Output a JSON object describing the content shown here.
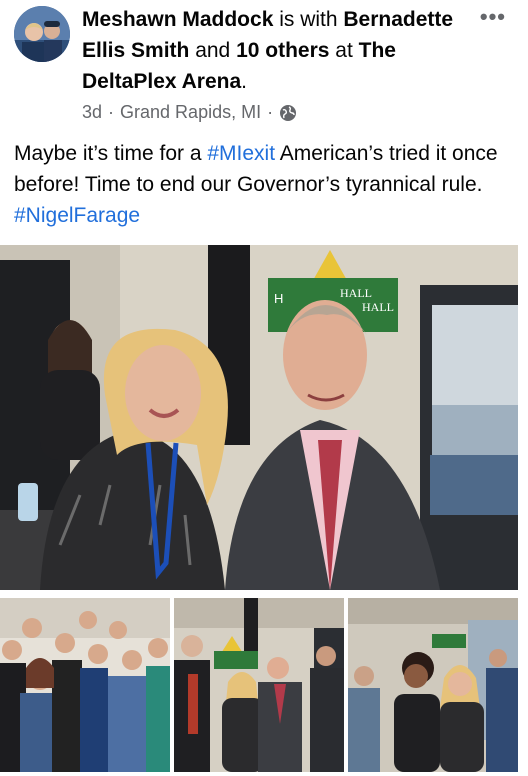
{
  "post": {
    "author": "Meshawn Maddock",
    "with_text": " is with ",
    "tagged_person": "Bernadette Ellis Smith",
    "and_text": " and ",
    "others": "10 others",
    "at_text": " at ",
    "location_place": "The DeltaPlex Arena",
    "period": ".",
    "time_ago": "3d",
    "separator": "·",
    "city": "Grand Rapids, MI",
    "separator2": "·",
    "privacy_icon": "globe-icon",
    "more_icon": "•••",
    "text_part1": "Maybe it’s time for a ",
    "hashtag1": "#MIexit",
    "text_part2": " American’s tried it once before! Time to end our Governor’s tyrannical rule. ",
    "hashtag2": "#NigelFarage"
  },
  "photos": {
    "main_sign_text_1": "HALL",
    "main_sign_text_2": "HALL",
    "main_sign_prefix": "H"
  },
  "colors": {
    "hashtag": "#216fdb",
    "meta_text": "#65676b",
    "sign_green": "#2f7a3a",
    "sign_yellow": "#e9c437"
  }
}
